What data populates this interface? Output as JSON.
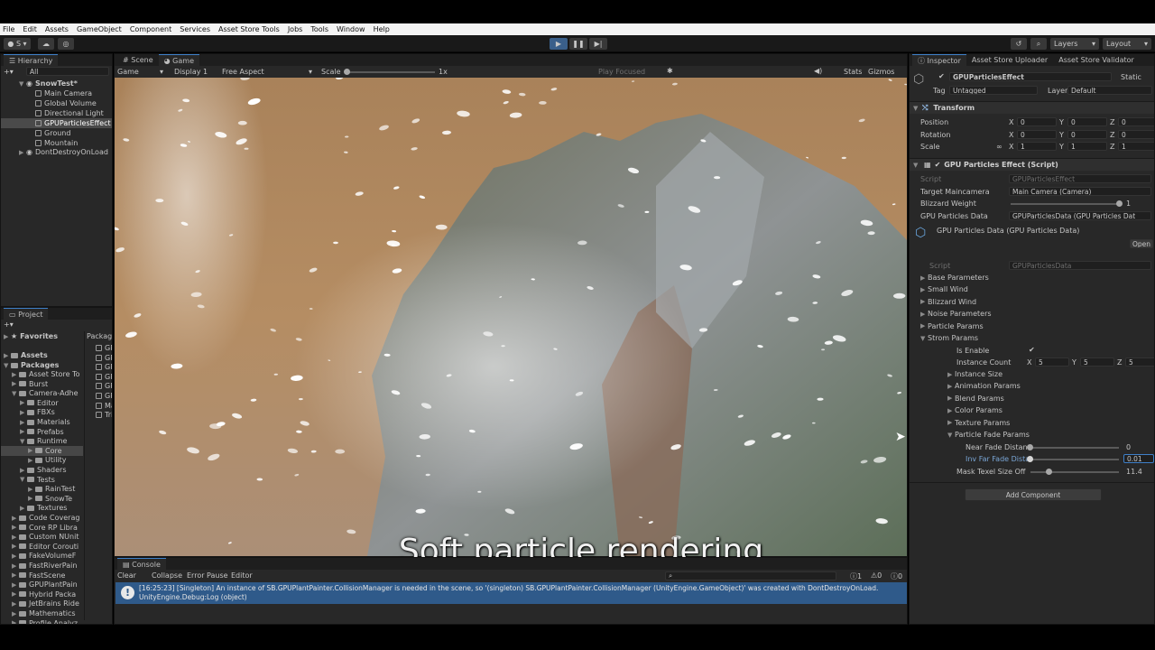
{
  "menu": [
    "File",
    "Edit",
    "Assets",
    "GameObject",
    "Component",
    "Services",
    "Asset Store Tools",
    "Jobs",
    "Tools",
    "Window",
    "Help"
  ],
  "toolbar": {
    "account": "S",
    "layers": "Layers",
    "layout": "Layout"
  },
  "hierarchy": {
    "tab": "Hierarchy",
    "search_placeholder": "All",
    "scene": "SnowTest*",
    "items": [
      "Main Camera",
      "Global Volume",
      "Directional Light",
      "GPUParticlesEffect",
      "Ground",
      "Mountain"
    ],
    "dontdestroy": "DontDestroyOnLoad"
  },
  "scene_tabs": {
    "scene": "Scene",
    "game": "Game"
  },
  "game_toolbar": {
    "mode": "Game",
    "display": "Display 1",
    "aspect": "Free Aspect",
    "scale_label": "Scale",
    "scale_value": "1x",
    "play_focused": "Play Focused",
    "stats": "Stats",
    "gizmos": "Gizmos"
  },
  "project": {
    "tab": "Project",
    "favorites": "Favorites",
    "assets": "Assets",
    "packages": "Packages",
    "tree": [
      "Asset Store To",
      "Burst",
      "Camera-Adhe",
      "Editor",
      "FBXs",
      "Materials",
      "Prefabs",
      "Runtime",
      "Core",
      "Utility",
      "Shaders",
      "Tests",
      "RainTest",
      "SnowTe",
      "Textures",
      "Code Coverag",
      "Core RP Libra",
      "Custom NUnit",
      "Editor Corouti",
      "FakeVolumeF",
      "FastRiverPain",
      "FastScene",
      "GPUPlantPain",
      "Hybrid Packa",
      "JetBrains Ride",
      "Mathematics",
      "Profile Analyz"
    ],
    "right_header": "Package",
    "right_items": [
      "GP",
      "GP",
      "GP",
      "GP",
      "GP",
      "GP",
      "Ma",
      "Tri"
    ]
  },
  "console": {
    "tab": "Console",
    "buttons": [
      "Clear",
      "Collapse",
      "Error Pause",
      "Editor"
    ],
    "counts": [
      "1",
      "0",
      "0"
    ],
    "message_line1": "[16:25:23] [Singleton] An instance of SB.GPUPlantPainter.CollisionManager is needed in the scene, so '(singleton) SB.GPUPlantPainter.CollisionManager (UnityEngine.GameObject)' was created with DontDestroyOnLoad.",
    "message_line2": "UnityEngine.Debug:Log (object)"
  },
  "caption": "Soft particle rendering",
  "inspector": {
    "tabs": [
      "Inspector",
      "Asset Store Uploader",
      "Asset Store Validator"
    ],
    "object_name": "GPUParticlesEffect",
    "static": "Static",
    "tag_label": "Tag",
    "tag_value": "Untagged",
    "layer_label": "Layer",
    "layer_value": "Default",
    "transform": "Transform",
    "position": "Position",
    "rotation": "Rotation",
    "scale": "Scale",
    "pos": [
      "0",
      "0",
      "0"
    ],
    "rot": [
      "0",
      "0",
      "0"
    ],
    "scl": [
      "1",
      "1",
      "1"
    ],
    "script_component": "GPU Particles Effect (Script)",
    "script_label": "Script",
    "script_value": "GPUParticlesEffect",
    "target_label": "Target Maincamera",
    "target_value": "Main Camera (Camera)",
    "blizzard_label": "Blizzard Weight",
    "blizzard_value": "1",
    "data_label": "GPU Particles Data",
    "data_value": "GPUParticlesData (GPU Particles Dat",
    "data_asset": "GPU Particles Data (GPU Particles Data)",
    "open": "Open",
    "data_script_label": "Script",
    "data_script_value": "GPUParticlesData",
    "groups": [
      "Base Parameters",
      "Small Wind",
      "Blizzard Wind",
      "Noise Parameters",
      "Particle Params",
      "Strom Params"
    ],
    "is_enable": "Is Enable",
    "instance_count": "Instance Count",
    "ic": [
      "5",
      "5",
      "5"
    ],
    "sub_groups": [
      "Instance Size",
      "Animation Params",
      "Blend Params",
      "Color Params",
      "Texture Params",
      "Particle Fade Params"
    ],
    "near_label": "Near Fade Distan",
    "near_value": "0",
    "inv_label": "Inv Far Fade Dista",
    "inv_value": "0.01",
    "mask_label": "Mask Texel Size Off",
    "mask_value": "11.4",
    "add_component": "Add Component"
  }
}
